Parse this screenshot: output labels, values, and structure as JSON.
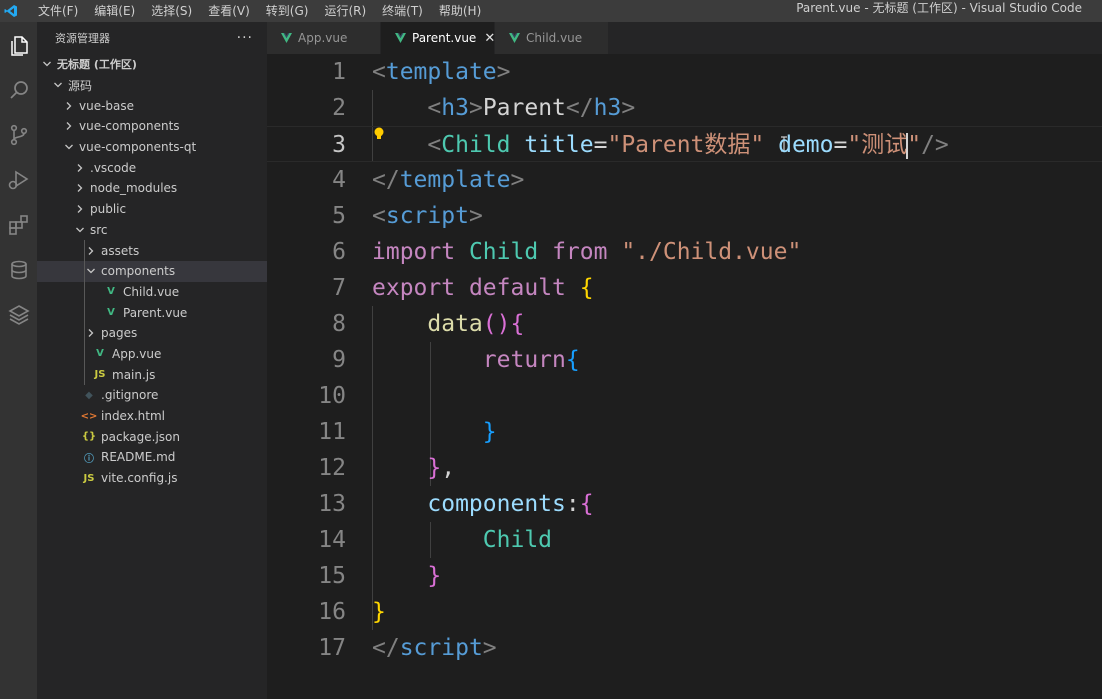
{
  "window": {
    "title": "Parent.vue - 无标题 (工作区) - Visual Studio Code"
  },
  "menu": [
    "文件(F)",
    "编辑(E)",
    "选择(S)",
    "查看(V)",
    "转到(G)",
    "运行(R)",
    "终端(T)",
    "帮助(H)"
  ],
  "sidebar": {
    "title": "资源管理器",
    "more": "···",
    "tree": [
      {
        "label": "无标题 (工作区)",
        "depth": 0,
        "chev": "v",
        "icon": "",
        "bold": true
      },
      {
        "label": "源码",
        "depth": 1,
        "chev": "v",
        "icon": ""
      },
      {
        "label": "vue-base",
        "depth": 2,
        "chev": ">",
        "icon": ""
      },
      {
        "label": "vue-components",
        "depth": 2,
        "chev": ">",
        "icon": ""
      },
      {
        "label": "vue-components-qt",
        "depth": 2,
        "chev": "v",
        "icon": ""
      },
      {
        "label": ".vscode",
        "depth": 3,
        "chev": ">",
        "icon": ""
      },
      {
        "label": "node_modules",
        "depth": 3,
        "chev": ">",
        "icon": ""
      },
      {
        "label": "public",
        "depth": 3,
        "chev": ">",
        "icon": ""
      },
      {
        "label": "src",
        "depth": 3,
        "chev": "v",
        "icon": ""
      },
      {
        "label": "assets",
        "depth": 4,
        "chev": ">",
        "icon": ""
      },
      {
        "label": "components",
        "depth": 4,
        "chev": "v",
        "icon": "",
        "selected": true
      },
      {
        "label": "Child.vue",
        "depth": 5,
        "chev": "",
        "icon": "vue"
      },
      {
        "label": "Parent.vue",
        "depth": 5,
        "chev": "",
        "icon": "vue"
      },
      {
        "label": "pages",
        "depth": 4,
        "chev": ">",
        "icon": ""
      },
      {
        "label": "App.vue",
        "depth": 4,
        "chev": "",
        "icon": "vue"
      },
      {
        "label": "main.js",
        "depth": 4,
        "chev": "",
        "icon": "js"
      },
      {
        "label": ".gitignore",
        "depth": 3,
        "chev": "",
        "icon": "git"
      },
      {
        "label": "index.html",
        "depth": 3,
        "chev": "",
        "icon": "html"
      },
      {
        "label": "package.json",
        "depth": 3,
        "chev": "",
        "icon": "json"
      },
      {
        "label": "README.md",
        "depth": 3,
        "chev": "",
        "icon": "info"
      },
      {
        "label": "vite.config.js",
        "depth": 3,
        "chev": "",
        "icon": "js"
      }
    ]
  },
  "tabs": [
    {
      "label": "App.vue",
      "active": false
    },
    {
      "label": "Parent.vue",
      "active": true
    },
    {
      "label": "Child.vue",
      "active": false
    }
  ],
  "icons": {
    "vue": "V",
    "js": "JS",
    "git": "◆",
    "html": "<>",
    "json": "{}",
    "info": "ⓘ",
    "close": "✕"
  },
  "colors": {
    "vue": "#41b883",
    "js": "#cbcb41",
    "git": "#41535b",
    "html": "#e37933",
    "json": "#cbcb41",
    "info": "#519aba",
    "lightbulb": "#ffcc00",
    "vscode_blue": "#23a9f2"
  },
  "editor": {
    "current_line": 3,
    "lines": [
      {
        "n": "1",
        "tokens": [
          [
            "tk-punc",
            "<"
          ],
          [
            "tk-tag",
            "template"
          ],
          [
            "tk-punc",
            ">"
          ]
        ]
      },
      {
        "n": "2",
        "tokens": [
          [
            "tk-txt",
            "    "
          ],
          [
            "tk-punc",
            "<"
          ],
          [
            "tk-tag",
            "h3"
          ],
          [
            "tk-punc",
            ">"
          ],
          [
            "tk-txt",
            "Parent"
          ],
          [
            "tk-punc",
            "</"
          ],
          [
            "tk-tag",
            "h3"
          ],
          [
            "tk-punc",
            ">"
          ]
        ]
      },
      {
        "n": "3",
        "tokens": [
          [
            "tk-txt",
            "    "
          ],
          [
            "tk-punc",
            "<"
          ],
          [
            "tk-comp",
            "Child"
          ],
          [
            "tk-txt",
            " "
          ],
          [
            "tk-attr",
            "title"
          ],
          [
            "tk-txt",
            "="
          ],
          [
            "tk-str",
            "\"Parent数据\""
          ],
          [
            "tk-txt",
            " "
          ],
          [
            "tk-attr",
            "demo"
          ],
          [
            "tk-txt",
            "="
          ],
          [
            "tk-str",
            "\"测试"
          ],
          [
            "cursor",
            ""
          ],
          [
            "tk-str",
            "\""
          ],
          [
            "tk-punc",
            "/>"
          ]
        ]
      },
      {
        "n": "4",
        "tokens": [
          [
            "tk-punc",
            "</"
          ],
          [
            "tk-tag",
            "template"
          ],
          [
            "tk-punc",
            ">"
          ]
        ]
      },
      {
        "n": "5",
        "tokens": [
          [
            "tk-punc",
            "<"
          ],
          [
            "tk-tag",
            "script"
          ],
          [
            "tk-punc",
            ">"
          ]
        ]
      },
      {
        "n": "6",
        "tokens": [
          [
            "tk-kw",
            "import"
          ],
          [
            "tk-txt",
            " "
          ],
          [
            "tk-comp",
            "Child"
          ],
          [
            "tk-txt",
            " "
          ],
          [
            "tk-kw",
            "from"
          ],
          [
            "tk-txt",
            " "
          ],
          [
            "tk-str",
            "\"./Child.vue\""
          ]
        ]
      },
      {
        "n": "7",
        "tokens": [
          [
            "tk-kw",
            "export"
          ],
          [
            "tk-txt",
            " "
          ],
          [
            "tk-kw",
            "default"
          ],
          [
            "tk-txt",
            " "
          ],
          [
            "tk-b1",
            "{"
          ]
        ]
      },
      {
        "n": "8",
        "tokens": [
          [
            "tk-txt",
            "    "
          ],
          [
            "tk-fn",
            "data"
          ],
          [
            "tk-b2",
            "()"
          ],
          [
            "tk-b2",
            "{"
          ]
        ]
      },
      {
        "n": "9",
        "tokens": [
          [
            "tk-txt",
            "        "
          ],
          [
            "tk-kw",
            "return"
          ],
          [
            "tk-b3",
            "{"
          ]
        ]
      },
      {
        "n": "10",
        "tokens": []
      },
      {
        "n": "11",
        "tokens": [
          [
            "tk-txt",
            "        "
          ],
          [
            "tk-b3",
            "}"
          ]
        ]
      },
      {
        "n": "12",
        "tokens": [
          [
            "tk-txt",
            "    "
          ],
          [
            "tk-b2",
            "}"
          ],
          [
            "tk-txt",
            ","
          ]
        ]
      },
      {
        "n": "13",
        "tokens": [
          [
            "tk-txt",
            "    "
          ],
          [
            "tk-attr",
            "components"
          ],
          [
            "tk-txt",
            ":"
          ],
          [
            "tk-b2",
            "{"
          ]
        ]
      },
      {
        "n": "14",
        "tokens": [
          [
            "tk-txt",
            "        "
          ],
          [
            "tk-comp",
            "Child"
          ]
        ]
      },
      {
        "n": "15",
        "tokens": [
          [
            "tk-txt",
            "    "
          ],
          [
            "tk-b2",
            "}"
          ]
        ]
      },
      {
        "n": "16",
        "tokens": [
          [
            "tk-b1",
            "}"
          ]
        ]
      },
      {
        "n": "17",
        "tokens": [
          [
            "tk-punc",
            "</"
          ],
          [
            "tk-tag",
            "script"
          ],
          [
            "tk-punc",
            ">"
          ]
        ]
      }
    ]
  }
}
